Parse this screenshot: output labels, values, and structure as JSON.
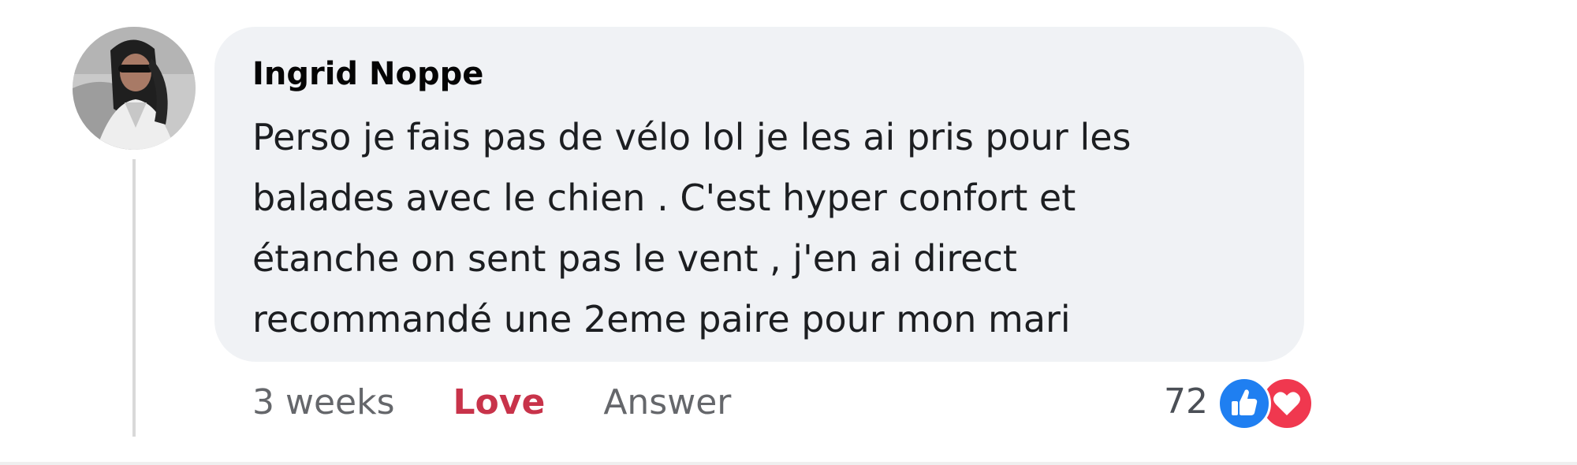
{
  "comment": {
    "author": "Ingrid Noppe",
    "lines": [
      "Perso je fais pas de vélo lol je les ai pris pour les",
      "balades avec le chien . C'est hyper confort et",
      "étanche on sent pas le vent , j'en ai direct",
      "recommandé une 2eme paire pour mon mari"
    ]
  },
  "actions": {
    "timestamp": "3 weeks",
    "reaction_label": "Love",
    "reply_label": "Answer"
  },
  "reactions": {
    "count": "72",
    "types": [
      "like-icon",
      "heart-icon"
    ],
    "like_color": "#1f7ff1",
    "love_color": "#f0384f"
  },
  "colors": {
    "bubble_background": "#f0f2f5",
    "love_text": "#c8334a",
    "secondary_text": "#65676b"
  }
}
